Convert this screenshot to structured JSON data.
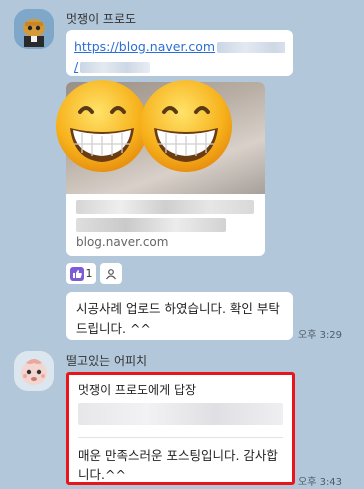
{
  "first_message": {
    "sender": "멋쟁이 프로도",
    "link_visible": "https://blog.naver.com",
    "link_line2": "/",
    "preview_domain": "blog.naver.com",
    "reaction_count": "1",
    "text": "시공사례 업로드 하였습니다. 확인 부탁드립니다. ^^",
    "time": "오후 3:29"
  },
  "second_message": {
    "sender": "떨고있는 어피치",
    "reply_header": "멋쟁이 프로도에게 답장",
    "body": "매운 만족스러운 포스팅입니다. 감사합니다.^^",
    "time": "오후 3:43"
  },
  "colors": {
    "background": "#b2c7da",
    "link": "#2b6fd6",
    "highlight_border": "#e8161b",
    "reaction_purple": "#7b5cd6"
  },
  "icons": [
    "thumbs-up-icon",
    "person-icon",
    "grinning-emoji-icon"
  ]
}
